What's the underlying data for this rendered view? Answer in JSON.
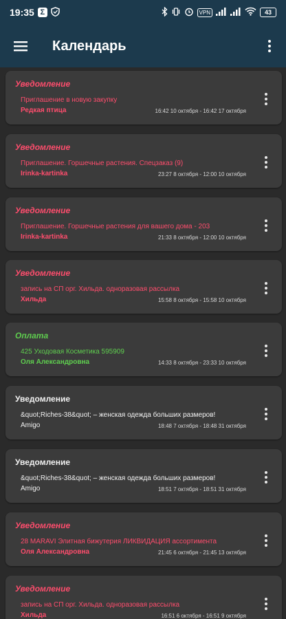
{
  "status_bar": {
    "time": "19:35",
    "sigma": "Σ",
    "vpn": "VPN",
    "battery": "43",
    "icons": [
      "sigma-icon",
      "shield-icon",
      "bluetooth-icon",
      "vibrate-icon",
      "alarm-icon",
      "vpn-icon",
      "signal-icon",
      "signal-icon",
      "wifi-icon",
      "battery-icon"
    ]
  },
  "app_bar": {
    "title": "Календарь",
    "menu_icon": "hamburger-menu-icon",
    "more_icon": "more-vertical-icon"
  },
  "colors": {
    "app_bar": "#1c3a4d",
    "background": "#2a2a2a",
    "card": "#3b3b3b",
    "notification": "#ff4d6d",
    "payment": "#5fcf4f",
    "neutral": "#f2f2f2"
  },
  "events": [
    {
      "type": "Уведомление",
      "color": "red",
      "description": "Приглашение в новую закупку",
      "author": "Редкая птица",
      "time": "16:42 10 октября - 16:42 17 октября"
    },
    {
      "type": "Уведомление",
      "color": "red",
      "description": "Приглашение. Горшечные растения. Спецзаказ (9)",
      "author": "Irinka-kartinka",
      "time": "23:27 8 октября - 12:00 10 октября"
    },
    {
      "type": "Уведомление",
      "color": "red",
      "description": "Приглашение. Горшечные растения для вашего дома - 203",
      "author": "Irinka-kartinka",
      "time": "21:33 8 октября - 12:00 10 октября"
    },
    {
      "type": "Уведомление",
      "color": "red",
      "description": "запись на СП орг. Хильда. одноразовая рассылка",
      "author": "Хильда",
      "time": "15:58 8 октября - 15:58 10 октября"
    },
    {
      "type": "Оплата",
      "color": "green",
      "description": "425 Уходовая Косметика 595909",
      "author": "Оля Александровна",
      "time": "14:33 8 октября - 23:33 10 октября"
    },
    {
      "type": "Уведомление",
      "color": "white",
      "description": "&quot;Riches-38&quot; – женская одежда больших размеров!",
      "author": "Amigo",
      "time": "18:48 7 октября - 18:48 31 октября"
    },
    {
      "type": "Уведомление",
      "color": "white",
      "description": "&quot;Riches-38&quot; – женская одежда больших размеров!",
      "author": "Amigo",
      "time": "18:51 7 октября - 18:51 31 октября"
    },
    {
      "type": "Уведомление",
      "color": "red",
      "description": "28 MARAVI Элитная бижутерия ЛИКВИДАЦИЯ ассортимента",
      "author": "Оля Александровна",
      "time": "21:45 6 октября - 21:45 13 октября"
    },
    {
      "type": "Уведомление",
      "color": "red",
      "description": "запись на СП орг. Хильда. одноразовая рассылка",
      "author": "Хильда",
      "time": "16:51 6 октября - 16:51 9 октября"
    }
  ]
}
